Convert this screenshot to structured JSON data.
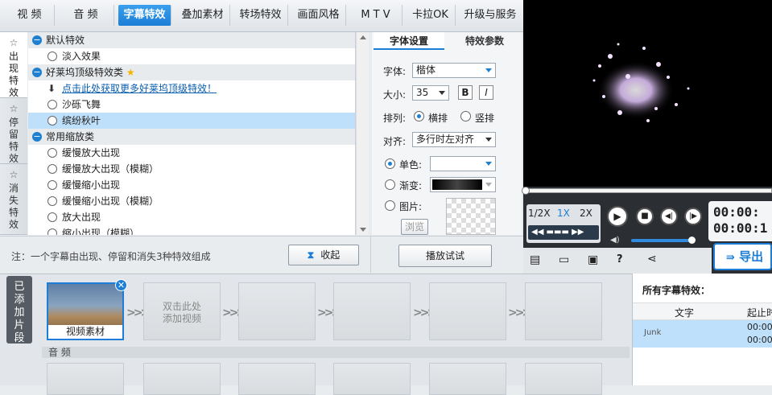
{
  "nav": {
    "tabs": [
      "视 频",
      "音 频",
      "字幕特效",
      "叠加素材",
      "转场特效",
      "画面风格",
      "M T V",
      "卡拉OK",
      "升级与服务"
    ],
    "active": 2
  },
  "side_tabs": [
    {
      "label": "出现特效"
    },
    {
      "label": "停留特效"
    },
    {
      "label": "消失特效"
    }
  ],
  "effects": [
    {
      "type": "cat",
      "label": "默认特效"
    },
    {
      "type": "item",
      "label": "淡入效果"
    },
    {
      "type": "cat",
      "label": "好莱坞顶级特效类",
      "star": true
    },
    {
      "type": "link",
      "label": "点击此处获取更多好莱坞顶级特效！"
    },
    {
      "type": "item",
      "label": "沙砾飞舞"
    },
    {
      "type": "item",
      "label": "缤纷秋叶",
      "selected": true
    },
    {
      "type": "cat",
      "label": "常用缩放类"
    },
    {
      "type": "item",
      "label": "缓慢放大出现"
    },
    {
      "type": "item",
      "label": "缓慢放大出现（模糊）"
    },
    {
      "type": "item",
      "label": "缓慢缩小出现"
    },
    {
      "type": "item",
      "label": "缓慢缩小出现（模糊）"
    },
    {
      "type": "item",
      "label": "放大出现"
    },
    {
      "type": "item",
      "label": "缩小出现（模糊）"
    }
  ],
  "settings": {
    "tabs": [
      "字体设置",
      "特效参数"
    ],
    "font_label": "字体:",
    "font_value": "楷体",
    "size_label": "大小:",
    "size_value": "35",
    "bold": "B",
    "italic": "I",
    "layout_label": "排列:",
    "horizontal": "横排",
    "vertical": "竖排",
    "align_label": "对齐:",
    "align_value": "多行时左对齐",
    "solid_label": "单色:",
    "gradient_label": "渐变:",
    "image_label": "图片:",
    "browse": "浏览"
  },
  "note": "注：一个字幕由出现、停留和消失3种特效组成",
  "collapse_label": "收起",
  "play_test_label": "播放试试",
  "player": {
    "speeds": [
      "1/2X",
      "1X",
      "2X"
    ],
    "time1": "00:00:",
    "time2": "00:00:1",
    "export": "导出"
  },
  "timeline": {
    "side_label": "已添加片段",
    "clip_label": "视频素材",
    "add_hint": "双击此处\n添加视频",
    "audio_label": "音 频"
  },
  "right_list": {
    "title": "所有字幕特效：",
    "col_text": "文字",
    "col_start": "起止时",
    "row_times": [
      "00:00",
      "00:00"
    ],
    "row_text": "Junk"
  },
  "colors": {
    "accent": "#1c7ed6",
    "selected_row": "#bfe0fb"
  }
}
